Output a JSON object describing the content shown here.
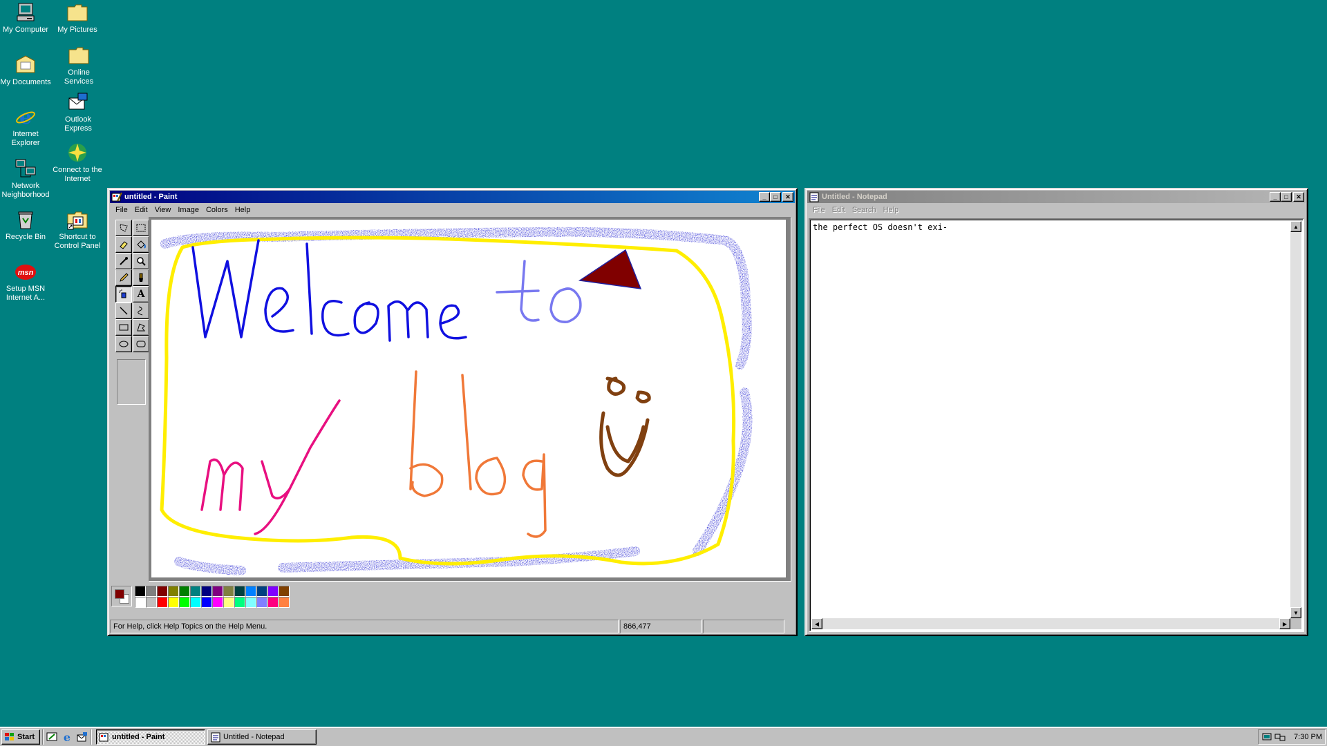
{
  "desktop": {
    "background": "#008080",
    "icons": [
      {
        "label": "My Computer",
        "icon": "computer-icon"
      },
      {
        "label": "My Pictures",
        "icon": "folder-icon"
      },
      {
        "label": "My Documents",
        "icon": "documents-folder-icon"
      },
      {
        "label": "Online\nServices",
        "icon": "folder-icon"
      },
      {
        "label": "Internet\nExplorer",
        "icon": "internet-explorer-icon"
      },
      {
        "label": "Outlook\nExpress",
        "icon": "outlook-express-icon"
      },
      {
        "label": "Network\nNeighborhood",
        "icon": "network-icon"
      },
      {
        "label": "Connect to the\nInternet",
        "icon": "connect-internet-icon"
      },
      {
        "label": "Recycle Bin",
        "icon": "recycle-bin-icon"
      },
      {
        "label": "Shortcut to\nControl Panel",
        "icon": "control-panel-icon"
      },
      {
        "label": "Setup MSN\nInternet A...",
        "icon": "msn-icon"
      }
    ]
  },
  "paint": {
    "title": "untitled - Paint",
    "menu": [
      "File",
      "Edit",
      "View",
      "Image",
      "Colors",
      "Help"
    ],
    "tools": [
      "free-select",
      "rect-select",
      "eraser",
      "fill",
      "color-picker",
      "magnifier",
      "pencil",
      "brush",
      "airbrush",
      "text",
      "line",
      "curve",
      "rectangle",
      "polygon",
      "ellipse",
      "rounded-rect"
    ],
    "selected_tool": "airbrush",
    "foreground_color": "#800000",
    "background_color": "#ffffff",
    "palette": [
      "#000000",
      "#808080",
      "#800000",
      "#808000",
      "#008000",
      "#008080",
      "#000080",
      "#800080",
      "#808040",
      "#004040",
      "#0080ff",
      "#004080",
      "#8000ff",
      "#804000",
      "#ffffff",
      "#c0c0c0",
      "#ff0000",
      "#ffff00",
      "#00ff00",
      "#00ffff",
      "#0000ff",
      "#ff00ff",
      "#ffff80",
      "#00ff80",
      "#80ffff",
      "#8080ff",
      "#ff0080",
      "#ff8040"
    ],
    "status_help": "For Help, click Help Topics on the Help Menu.",
    "status_coords": "866,477",
    "drawing_words": [
      "Welcome",
      "to",
      "my",
      "blog"
    ]
  },
  "notepad": {
    "title": "Untitled - Notepad",
    "menu": [
      "File",
      "Edit",
      "Search",
      "Help"
    ],
    "text": "the perfect OS doesn't exi-"
  },
  "taskbar": {
    "start_label": "Start",
    "quick_launch": [
      "show-desktop-icon",
      "internet-explorer-icon",
      "outlook-express-icon"
    ],
    "tasks": [
      {
        "label": "untitled - Paint",
        "active": true
      },
      {
        "label": "Untitled - Notepad",
        "active": false
      }
    ],
    "clock": "7:30 PM"
  }
}
